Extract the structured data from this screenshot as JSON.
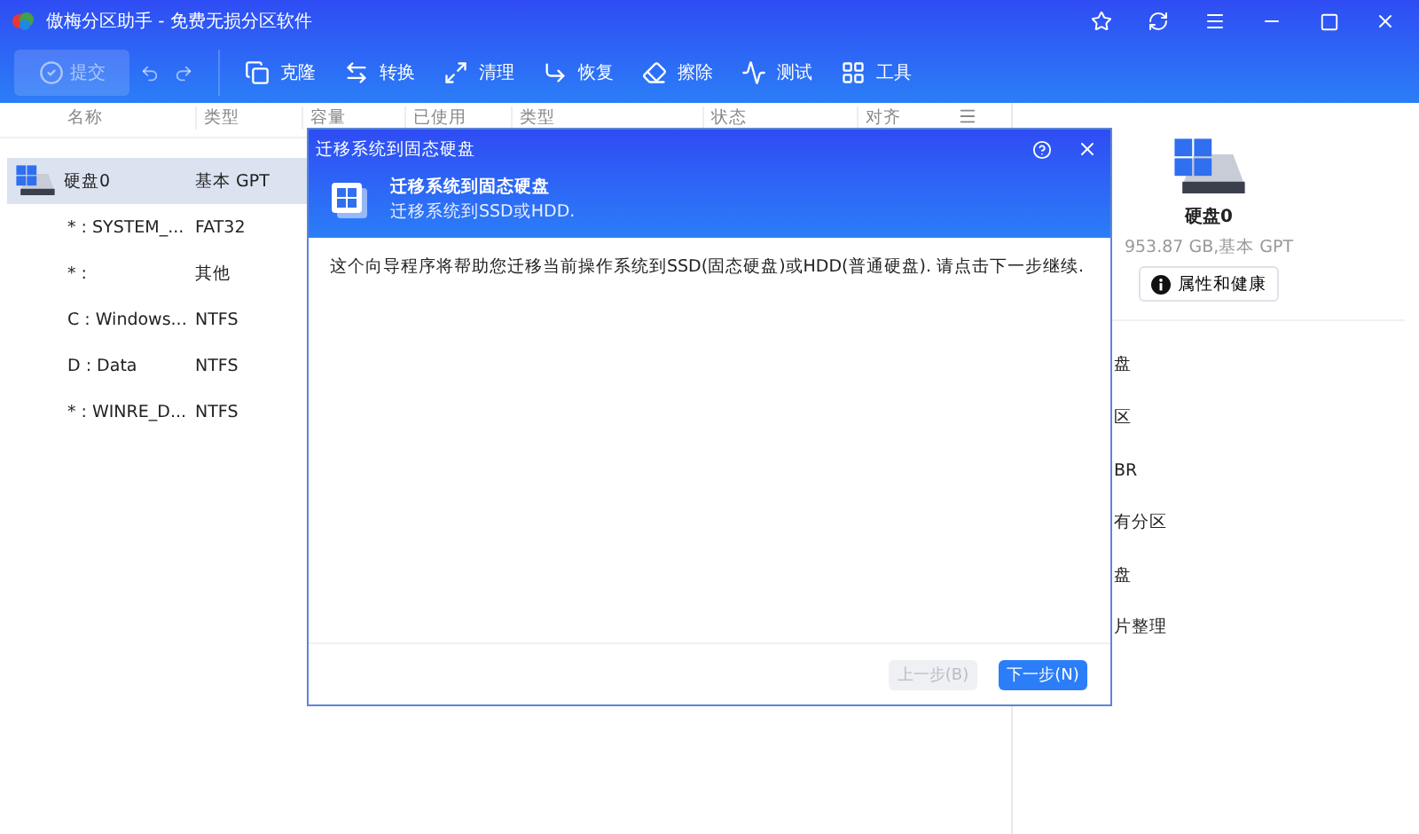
{
  "window": {
    "title": "傲梅分区助手 - 免费无损分区软件"
  },
  "toolbar": {
    "commit": {
      "label": "提交",
      "disabled": true
    },
    "tools": [
      {
        "label": "克隆",
        "kind": "clone"
      },
      {
        "label": "转换",
        "kind": "convert"
      },
      {
        "label": "清理",
        "kind": "cleanup"
      },
      {
        "label": "恢复",
        "kind": "recover"
      },
      {
        "label": "擦除",
        "kind": "wipe"
      },
      {
        "label": "测试",
        "kind": "test"
      },
      {
        "label": "工具",
        "kind": "tools"
      }
    ]
  },
  "table": {
    "columns": [
      "名称",
      "类型",
      "容量",
      "已使用",
      "类型",
      "状态",
      "对齐"
    ],
    "rows": [
      {
        "kind": "disk",
        "cells": [
          "硬盘0",
          "基本 GPT"
        ],
        "selected": true
      },
      {
        "kind": "partition",
        "cells": [
          "* : SYSTEM_...",
          "FAT32"
        ],
        "selected": false
      },
      {
        "kind": "partition",
        "cells": [
          "* :",
          "其他"
        ],
        "selected": false
      },
      {
        "kind": "partition",
        "cells": [
          "C : Windows...",
          "NTFS"
        ],
        "selected": false
      },
      {
        "kind": "partition",
        "cells": [
          "D : Data",
          "NTFS"
        ],
        "selected": false
      },
      {
        "kind": "partition",
        "cells": [
          "* : WINRE_D...",
          "NTFS"
        ],
        "selected": false
      }
    ]
  },
  "side_panel": {
    "disk_name": "硬盘0",
    "disk_info": "953.87 GB,基本 GPT",
    "properties_button": "属性和健康",
    "operations": [
      "盘",
      "区",
      "BR",
      "有分区",
      "盘",
      "片整理"
    ]
  },
  "dialog": {
    "title": "迁移系统到固态硬盘",
    "heading": "迁移系统到固态硬盘",
    "subheading": "迁移系统到SSD或HDD.",
    "body": "这个向导程序将帮助您迁移当前操作系统到SSD(固态硬盘)或HDD(普通硬盘). 请点击下一步继续.",
    "buttons": [
      {
        "label": "上一步(B)",
        "disabled": true
      },
      {
        "label": "下一步(N)",
        "disabled": false
      }
    ]
  }
}
